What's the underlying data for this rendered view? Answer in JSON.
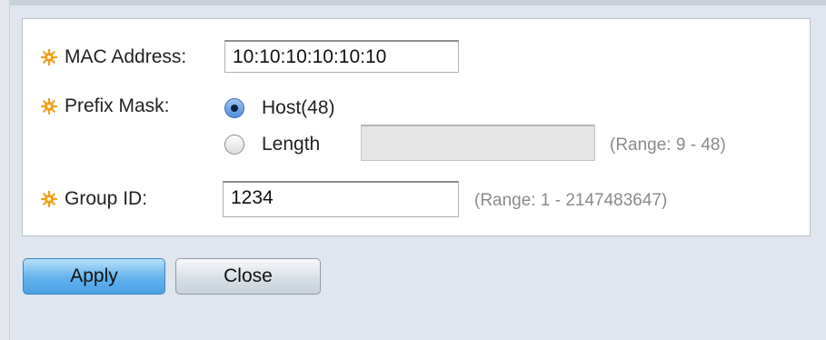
{
  "form": {
    "mac_address": {
      "label": "MAC Address:",
      "value": "10:10:10:10:10:10"
    },
    "prefix_mask": {
      "label": "Prefix Mask:",
      "options": [
        {
          "label": "Host(48)",
          "selected": true
        },
        {
          "label": "Length",
          "selected": false
        }
      ],
      "length_value": "",
      "length_range": "(Range: 9 - 48)"
    },
    "group_id": {
      "label": "Group ID:",
      "value": "1234",
      "range": "(Range: 1 - 2147483647)"
    }
  },
  "buttons": {
    "apply_label": "Apply",
    "close_label": "Close"
  },
  "colors": {
    "required_icon": "#f0a019",
    "apply_button": "#62b2ee",
    "close_button": "#d5dde5",
    "hint_text": "#8a8a8a"
  },
  "icons": {
    "required": "gear-icon"
  }
}
